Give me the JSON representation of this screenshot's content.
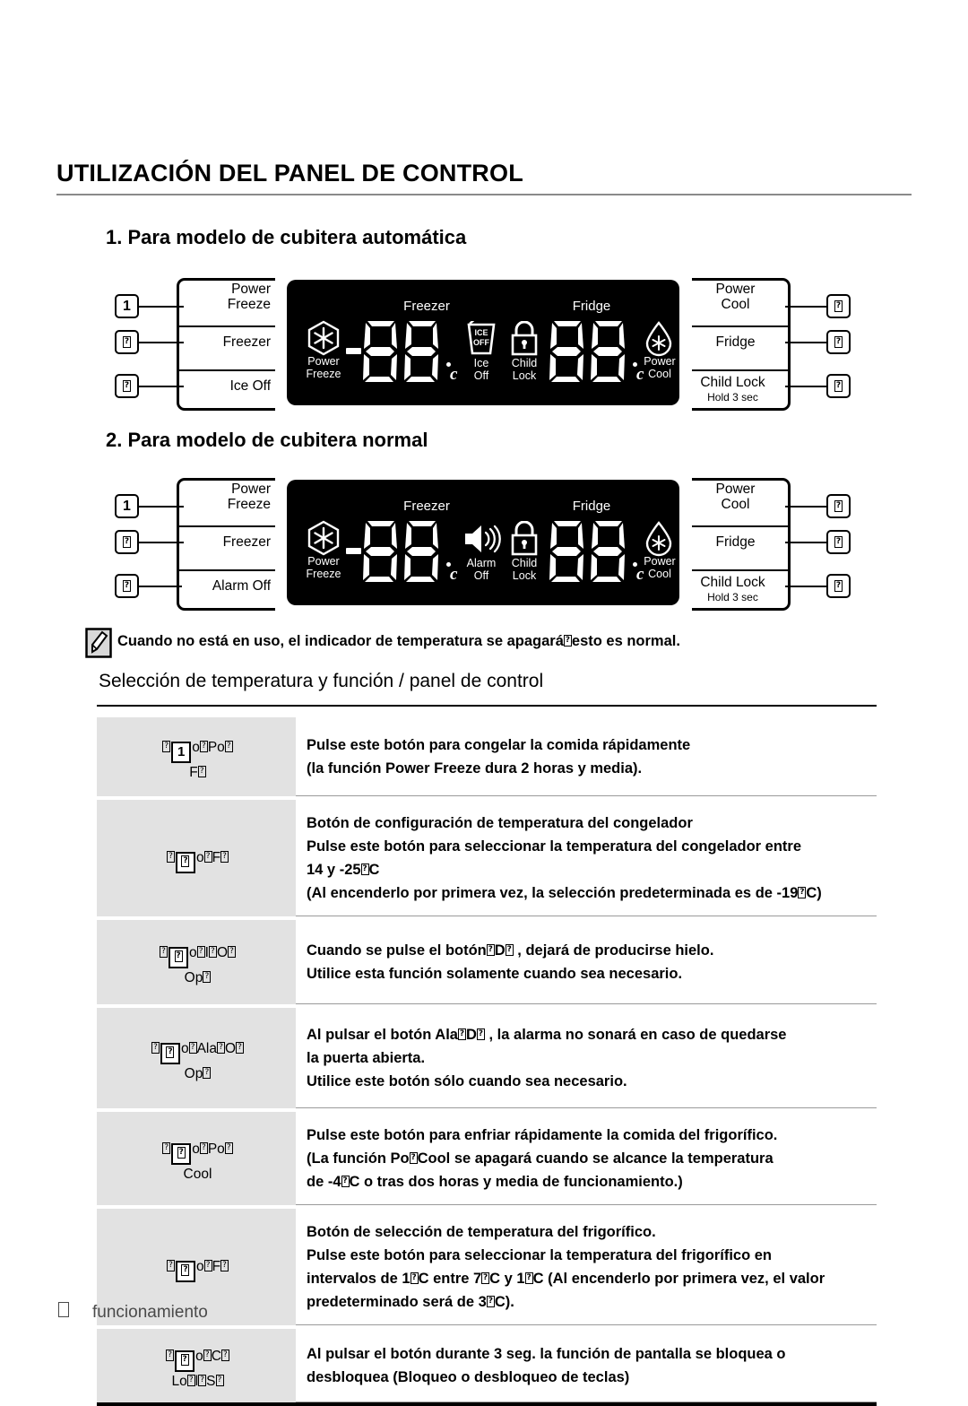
{
  "page": {
    "title": "UTILIZACIÓN DEL PANEL DE CONTROL",
    "footer_label": "funcionamiento",
    "footer_marker": "?"
  },
  "sections": {
    "s1_heading": "1. Para modelo de cubitera automática",
    "s2_heading": "2. Para modelo de cubitera normal"
  },
  "note": {
    "text": "Cuando no está en uso, el indicador de temperatura se apagará⊡esto es normal.",
    "text_before": "Cuando no está en uso, el indicador de temperatura se apagará",
    "text_after": "esto es normal.",
    "icon": "note-pencil-icon"
  },
  "subheading": "Selección de temperatura y función / panel de control",
  "panel1": {
    "left_callouts": [
      {
        "marker": "1",
        "label": "Power Freeze",
        "line1": "Power",
        "line2": "Freeze"
      },
      {
        "marker": "?",
        "label": "Freezer",
        "line1": "Freezer",
        "line2": ""
      },
      {
        "marker": "?",
        "label": "Ice Off",
        "line1": "Ice Off",
        "line2": ""
      }
    ],
    "right_callouts": [
      {
        "marker": "?",
        "label": "Power Cool",
        "line1": "Power",
        "line2": "Cool",
        "sub": ""
      },
      {
        "marker": "?",
        "label": "Fridge",
        "line1": "Fridge",
        "line2": "",
        "sub": ""
      },
      {
        "marker": "?",
        "label": "Child Lock",
        "line1": "Child Lock",
        "line2": "",
        "sub": "Hold 3 sec"
      }
    ],
    "display": {
      "freezer_title": "Freezer",
      "fridge_title": "Fridge",
      "freezer_value": "88",
      "fridge_value": "88",
      "unit": "c",
      "power_freeze_l1": "Power",
      "power_freeze_l2": "Freeze",
      "mid_icon1_l1": "Ice",
      "mid_icon1_l2": "Off",
      "mid_icon1_glyph_top": "ICE",
      "mid_icon1_glyph_bot": "OFF",
      "mid_icon2_l1": "Child",
      "mid_icon2_l2": "Lock",
      "power_cool_l1": "Power",
      "power_cool_l2": "Cool",
      "minus_sign": "-"
    }
  },
  "panel2": {
    "left_callouts": [
      {
        "marker": "1",
        "label": "Power Freeze",
        "line1": "Power",
        "line2": "Freeze"
      },
      {
        "marker": "?",
        "label": "Freezer",
        "line1": "Freezer",
        "line2": ""
      },
      {
        "marker": "?",
        "label": "Alarm Off",
        "line1": "Alarm Off",
        "line2": ""
      }
    ],
    "right_callouts": [
      {
        "marker": "?",
        "label": "Power Cool",
        "line1": "Power",
        "line2": "Cool",
        "sub": ""
      },
      {
        "marker": "?",
        "label": "Fridge",
        "line1": "Fridge",
        "line2": "",
        "sub": ""
      },
      {
        "marker": "?",
        "label": "Child Lock",
        "line1": "Child Lock",
        "line2": "",
        "sub": "Hold 3 sec"
      }
    ],
    "display": {
      "freezer_title": "Freezer",
      "fridge_title": "Fridge",
      "freezer_value": "88",
      "fridge_value": "88",
      "unit": "c",
      "power_freeze_l1": "Power",
      "power_freeze_l2": "Freeze",
      "mid_icon1_l1": "Alarm",
      "mid_icon1_l2": "Off",
      "mid_icon2_l1": "Child",
      "mid_icon2_l2": "Lock",
      "power_cool_l1": "Power",
      "power_cool_l2": "Cool",
      "minus_sign": "-"
    }
  },
  "table": {
    "rows": [
      {
        "button_line1_pre": "",
        "button_num": "1",
        "button_line1_post": "o?Po?",
        "button_line2": "F?",
        "lines": [
          "Pulse este botón para congelar la comida rápidamente",
          "(la función Power Freeze dura 2 horas y media)."
        ]
      },
      {
        "button_line1_pre": "",
        "button_num": "?",
        "button_line1_post": "o?F?",
        "button_line2": "",
        "lines": [
          "Botón de configuración de temperatura del congelador",
          "Pulse este botón para seleccionar la temperatura del congelador entre",
          "14 y -25⊡C",
          "(Al encenderlo por primera vez, la selección predeterminada es de -19⊡C)"
        ]
      },
      {
        "button_line1_pre": "",
        "button_num": "?",
        "button_line1_post": "o?I?O?",
        "button_line2": "Op?",
        "lines": [
          "Cuando se pulse el botón⊡D⊡ , dejará de producirse hielo.",
          "Utilice esta función solamente cuando sea necesario."
        ]
      },
      {
        "button_line1_pre": "",
        "button_num": "?",
        "button_line1_post": "o?Ala?O?",
        "button_line2": "Op?",
        "lines": [
          "Al pulsar el botón Ala⊡D⊡ , la alarma no sonará en caso de quedarse",
          "la puerta abierta.",
          "Utilice este botón sólo cuando sea necesario."
        ]
      },
      {
        "button_line1_pre": "",
        "button_num": "?",
        "button_line1_post": "o?Po?",
        "button_line2": "Cool",
        "lines": [
          "Pulse este botón para enfriar rápidamente la comida del frigorífico.",
          "(La función Po⊡Cool se apagará cuando se alcance la temperatura",
          "de -4⊡C o tras dos horas y media de funcionamiento.)"
        ]
      },
      {
        "button_line1_pre": "",
        "button_num": "?",
        "button_line1_post": "o?F?",
        "button_line2": "",
        "lines": [
          "Botón de selección de temperatura del frigorífico.",
          "Pulse este botón para seleccionar la temperatura del frigorífico en",
          "intervalos de 1⊡C entre 7⊡C y 1⊡C (Al encenderlo por primera vez, el valor",
          "predeterminado será de 3⊡C)."
        ]
      },
      {
        "button_line1_pre": "",
        "button_num": "?",
        "button_line1_post": "o?C?",
        "button_line2": "Lo?l?S?",
        "lines": [
          "Al pulsar el botón durante 3 seg. la función de pantalla se bloquea o",
          "desbloquea (Bloqueo o desbloqueo de teclas)"
        ]
      }
    ]
  }
}
